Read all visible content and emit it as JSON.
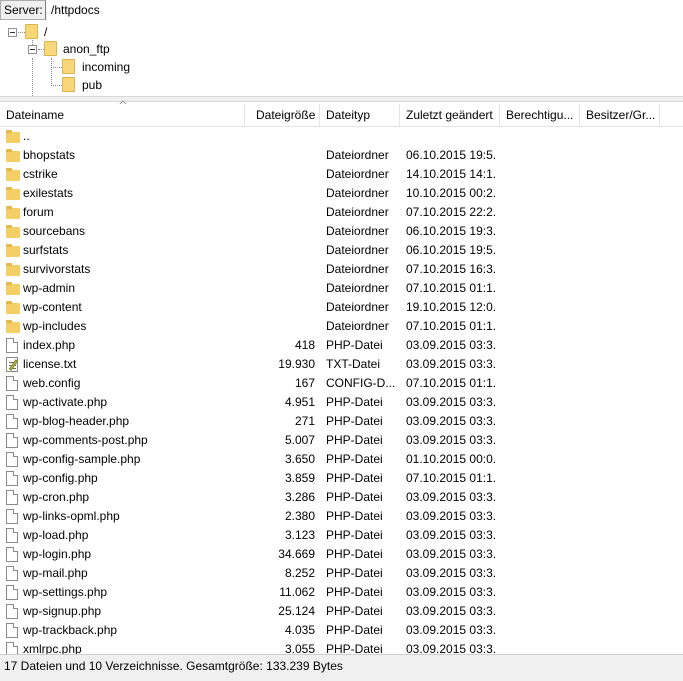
{
  "pathbar": {
    "label": "Server:",
    "value": "/httpdocs"
  },
  "tree": {
    "root": "/",
    "anon_ftp": "anon_ftp",
    "incoming": "incoming",
    "pub": "pub"
  },
  "columns": {
    "name": "Dateiname",
    "size": "Dateigröße",
    "type": "Dateityp",
    "modified": "Zuletzt geändert",
    "perms": "Berechtigu...",
    "owner": "Besitzer/Gr..."
  },
  "rows": [
    {
      "icon": "folder-icon",
      "name": "..",
      "size": "",
      "type": "",
      "date": ""
    },
    {
      "icon": "folder-icon",
      "name": "bhopstats",
      "size": "",
      "type": "Dateiordner",
      "date": "06.10.2015 19:5..."
    },
    {
      "icon": "folder-icon",
      "name": "cstrike",
      "size": "",
      "type": "Dateiordner",
      "date": "14.10.2015 14:1..."
    },
    {
      "icon": "folder-icon",
      "name": "exilestats",
      "size": "",
      "type": "Dateiordner",
      "date": "10.10.2015 00:2..."
    },
    {
      "icon": "folder-icon",
      "name": "forum",
      "size": "",
      "type": "Dateiordner",
      "date": "07.10.2015 22:2..."
    },
    {
      "icon": "folder-icon",
      "name": "sourcebans",
      "size": "",
      "type": "Dateiordner",
      "date": "06.10.2015 19:3..."
    },
    {
      "icon": "folder-icon",
      "name": "surfstats",
      "size": "",
      "type": "Dateiordner",
      "date": "06.10.2015 19:5..."
    },
    {
      "icon": "folder-icon",
      "name": "survivorstats",
      "size": "",
      "type": "Dateiordner",
      "date": "07.10.2015 16:3..."
    },
    {
      "icon": "folder-icon",
      "name": "wp-admin",
      "size": "",
      "type": "Dateiordner",
      "date": "07.10.2015 01:1..."
    },
    {
      "icon": "folder-icon",
      "name": "wp-content",
      "size": "",
      "type": "Dateiordner",
      "date": "19.10.2015 12:0..."
    },
    {
      "icon": "folder-icon",
      "name": "wp-includes",
      "size": "",
      "type": "Dateiordner",
      "date": "07.10.2015 01:1..."
    },
    {
      "icon": "file-icon",
      "name": "index.php",
      "size": "418",
      "type": "PHP-Datei",
      "date": "03.09.2015 03:3..."
    },
    {
      "icon": "text-file-icon",
      "name": "license.txt",
      "size": "19.930",
      "type": "TXT-Datei",
      "date": "03.09.2015 03:3..."
    },
    {
      "icon": "file-icon",
      "name": "web.config",
      "size": "167",
      "type": "CONFIG-D...",
      "date": "07.10.2015 01:1..."
    },
    {
      "icon": "file-icon",
      "name": "wp-activate.php",
      "size": "4.951",
      "type": "PHP-Datei",
      "date": "03.09.2015 03:3..."
    },
    {
      "icon": "file-icon",
      "name": "wp-blog-header.php",
      "size": "271",
      "type": "PHP-Datei",
      "date": "03.09.2015 03:3..."
    },
    {
      "icon": "file-icon",
      "name": "wp-comments-post.php",
      "size": "5.007",
      "type": "PHP-Datei",
      "date": "03.09.2015 03:3..."
    },
    {
      "icon": "file-icon",
      "name": "wp-config-sample.php",
      "size": "3.650",
      "type": "PHP-Datei",
      "date": "01.10.2015 00:0..."
    },
    {
      "icon": "file-icon",
      "name": "wp-config.php",
      "size": "3.859",
      "type": "PHP-Datei",
      "date": "07.10.2015 01:1..."
    },
    {
      "icon": "file-icon",
      "name": "wp-cron.php",
      "size": "3.286",
      "type": "PHP-Datei",
      "date": "03.09.2015 03:3..."
    },
    {
      "icon": "file-icon",
      "name": "wp-links-opml.php",
      "size": "2.380",
      "type": "PHP-Datei",
      "date": "03.09.2015 03:3..."
    },
    {
      "icon": "file-icon",
      "name": "wp-load.php",
      "size": "3.123",
      "type": "PHP-Datei",
      "date": "03.09.2015 03:3..."
    },
    {
      "icon": "file-icon",
      "name": "wp-login.php",
      "size": "34.669",
      "type": "PHP-Datei",
      "date": "03.09.2015 03:3..."
    },
    {
      "icon": "file-icon",
      "name": "wp-mail.php",
      "size": "8.252",
      "type": "PHP-Datei",
      "date": "03.09.2015 03:3..."
    },
    {
      "icon": "file-icon",
      "name": "wp-settings.php",
      "size": "11.062",
      "type": "PHP-Datei",
      "date": "03.09.2015 03:3..."
    },
    {
      "icon": "file-icon",
      "name": "wp-signup.php",
      "size": "25.124",
      "type": "PHP-Datei",
      "date": "03.09.2015 03:3..."
    },
    {
      "icon": "file-icon",
      "name": "wp-trackback.php",
      "size": "4.035",
      "type": "PHP-Datei",
      "date": "03.09.2015 03:3..."
    },
    {
      "icon": "file-icon",
      "name": "xmlrpc.php",
      "size": "3.055",
      "type": "PHP-Datei",
      "date": "03.09.2015 03:3..."
    }
  ],
  "status": "17 Dateien und 10 Verzeichnisse. Gesamtgröße: 133.239 Bytes"
}
